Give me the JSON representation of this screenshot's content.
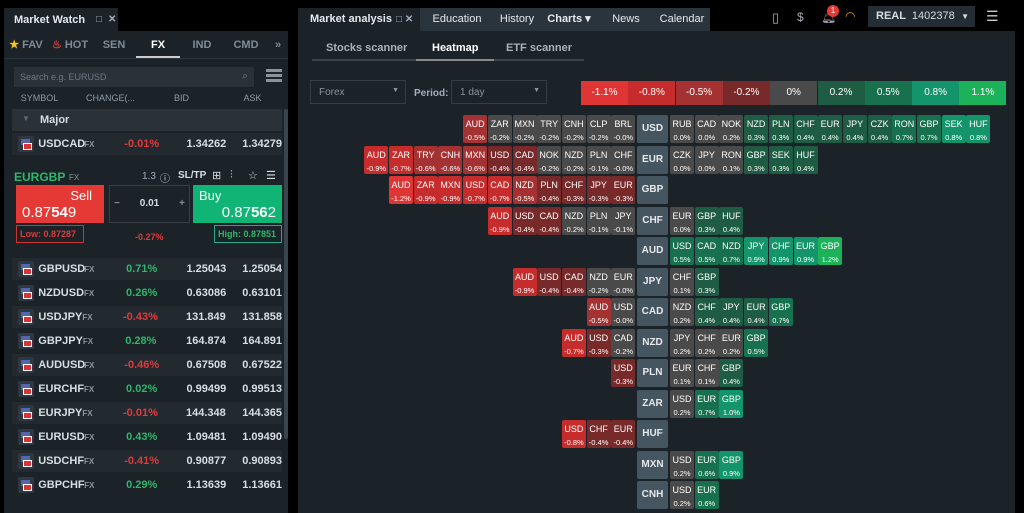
{
  "market_watch": {
    "title": "Market Watch",
    "tabs": [
      "FAV",
      "HOT",
      "SEN",
      "FX",
      "IND",
      "CMD"
    ],
    "active_tab": "FX",
    "search_placeholder": "Search e.g. EURUSD",
    "columns": [
      "SYMBOL",
      "CHANGE(...",
      "BID",
      "ASK"
    ],
    "group": "Major",
    "pinned": {
      "symbol": "USDCAD",
      "type": "FX",
      "change": "-0.01%",
      "bid": "1.34262",
      "ask": "1.34279"
    },
    "ticket": {
      "symbol": "EURGBP",
      "type": "FX",
      "spread": "1.3",
      "sltp": "SL/TP",
      "sell_label": "Sell",
      "sell_price_a": "0.87",
      "sell_price_b": "54",
      "sell_price_c": "9",
      "buy_label": "Buy",
      "buy_price_a": "0.87",
      "buy_price_b": "56",
      "buy_price_c": "2",
      "volume": "0.01",
      "low": "Low: 0.87287",
      "high": "High: 0.87851",
      "change": "-0.27%"
    },
    "rows": [
      {
        "symbol": "GBPUSD",
        "type": "FX",
        "change": "0.71%",
        "bid": "1.25043",
        "ask": "1.25054"
      },
      {
        "symbol": "NZDUSD",
        "type": "FX",
        "change": "0.26%",
        "bid": "0.63086",
        "ask": "0.63101"
      },
      {
        "symbol": "USDJPY",
        "type": "FX",
        "change": "-0.43%",
        "bid": "131.849",
        "ask": "131.858"
      },
      {
        "symbol": "GBPJPY",
        "type": "FX",
        "change": "0.28%",
        "bid": "164.874",
        "ask": "164.891"
      },
      {
        "symbol": "AUDUSD",
        "type": "FX",
        "change": "-0.46%",
        "bid": "0.67508",
        "ask": "0.67522"
      },
      {
        "symbol": "EURCHF",
        "type": "FX",
        "change": "0.02%",
        "bid": "0.99499",
        "ask": "0.99513"
      },
      {
        "symbol": "EURJPY",
        "type": "FX",
        "change": "-0.01%",
        "bid": "144.348",
        "ask": "144.365"
      },
      {
        "symbol": "EURUSD",
        "type": "FX",
        "change": "0.43%",
        "bid": "1.09481",
        "ask": "1.09490"
      },
      {
        "symbol": "USDCHF",
        "type": "FX",
        "change": "-0.41%",
        "bid": "0.90877",
        "ask": "0.90893"
      },
      {
        "symbol": "GBPCHF",
        "type": "FX",
        "change": "0.29%",
        "bid": "1.13639",
        "ask": "1.13661"
      }
    ]
  },
  "header": {
    "panel_title": "Market analysis",
    "tabs": [
      "Education",
      "History",
      "Charts ▾",
      "News",
      "Calendar"
    ],
    "notifications": "1",
    "account_type": "REAL",
    "account_number": "1402378"
  },
  "analysis": {
    "subtabs": [
      "Stocks scanner",
      "Heatmap",
      "ETF scanner"
    ],
    "active_subtab": "Heatmap",
    "market": "Forex",
    "period_label": "Period:",
    "period": "1 day",
    "legend": [
      {
        "label": "-1.1%",
        "color": "#e03535"
      },
      {
        "label": "-0.8%",
        "color": "#c62c2c"
      },
      {
        "label": "-0.5%",
        "color": "#a53232"
      },
      {
        "label": "-0.2%",
        "color": "#782a2a"
      },
      {
        "label": "0%",
        "color": "#4a4a4a"
      },
      {
        "label": "0.2%",
        "color": "#1e5c44"
      },
      {
        "label": "0.5%",
        "color": "#17704e"
      },
      {
        "label": "0.8%",
        "color": "#14946a"
      },
      {
        "label": "1.1%",
        "color": "#1bb25a"
      }
    ],
    "heatmap": [
      {
        "base": "USD",
        "left": [
          [
            "AUD",
            "-0.5%"
          ],
          [
            "ZAR",
            "-0.2%"
          ],
          [
            "MXN",
            "-0.2%"
          ],
          [
            "TRY",
            "-0.2%"
          ],
          [
            "CNH",
            "-0.2%"
          ],
          [
            "CLP",
            "-0.2%"
          ],
          [
            "BRL",
            "-0.0%"
          ]
        ],
        "right": [
          [
            "RUB",
            "0.0%"
          ],
          [
            "CAD",
            "0.0%"
          ],
          [
            "NOK",
            "0.2%"
          ],
          [
            "NZD",
            "0.3%"
          ],
          [
            "PLN",
            "0.3%"
          ],
          [
            "CHF",
            "0.4%"
          ],
          [
            "EUR",
            "0.4%"
          ],
          [
            "JPY",
            "0.4%"
          ],
          [
            "CZK",
            "0.4%"
          ],
          [
            "RON",
            "0.7%"
          ],
          [
            "GBP",
            "0.7%"
          ],
          [
            "SEK",
            "0.8%"
          ],
          [
            "HUF",
            "0.8%"
          ]
        ]
      },
      {
        "base": "EUR",
        "left": [
          [
            "AUD",
            "-0.9%"
          ],
          [
            "ZAR",
            "-0.7%"
          ],
          [
            "TRY",
            "-0.6%"
          ],
          [
            "CNH",
            "-0.6%"
          ],
          [
            "MXN",
            "-0.6%"
          ],
          [
            "USD",
            "-0.4%"
          ],
          [
            "CAD",
            "-0.4%"
          ],
          [
            "NOK",
            "-0.2%"
          ],
          [
            "NZD",
            "-0.2%"
          ],
          [
            "PLN",
            "-0.1%"
          ],
          [
            "CHF",
            "-0.0%"
          ]
        ],
        "right": [
          [
            "CZK",
            "0.0%"
          ],
          [
            "JPY",
            "0.0%"
          ],
          [
            "RON",
            "0.1%"
          ],
          [
            "GBP",
            "0.3%"
          ],
          [
            "SEK",
            "0.3%"
          ],
          [
            "HUF",
            "0.4%"
          ]
        ]
      },
      {
        "base": "GBP",
        "left": [
          [
            "AUD",
            "-1.2%"
          ],
          [
            "ZAR",
            "-0.9%"
          ],
          [
            "MXN",
            "-0.9%"
          ],
          [
            "USD",
            "-0.7%"
          ],
          [
            "CAD",
            "-0.7%"
          ],
          [
            "NZD",
            "-0.5%"
          ],
          [
            "PLN",
            "-0.4%"
          ],
          [
            "CHF",
            "-0.3%"
          ],
          [
            "JPY",
            "-0.3%"
          ],
          [
            "EUR",
            "-0.3%"
          ]
        ],
        "right": []
      },
      {
        "base": "CHF",
        "left": [
          [
            "AUD",
            "-0.9%"
          ],
          [
            "USD",
            "-0.4%"
          ],
          [
            "CAD",
            "-0.4%"
          ],
          [
            "NZD",
            "-0.2%"
          ],
          [
            "PLN",
            "-0.1%"
          ],
          [
            "JPY",
            "-0.1%"
          ]
        ],
        "right": [
          [
            "EUR",
            "0.0%"
          ],
          [
            "GBP",
            "0.3%"
          ],
          [
            "HUF",
            "0.4%"
          ]
        ]
      },
      {
        "base": "AUD",
        "left": [],
        "right": [
          [
            "USD",
            "0.5%"
          ],
          [
            "CAD",
            "0.5%"
          ],
          [
            "NZD",
            "0.7%"
          ],
          [
            "JPY",
            "0.9%"
          ],
          [
            "CHF",
            "0.9%"
          ],
          [
            "EUR",
            "0.9%"
          ],
          [
            "GBP",
            "1.2%"
          ]
        ]
      },
      {
        "base": "JPY",
        "left": [
          [
            "AUD",
            "-0.9%"
          ],
          [
            "USD",
            "-0.4%"
          ],
          [
            "CAD",
            "-0.4%"
          ],
          [
            "NZD",
            "-0.2%"
          ],
          [
            "EUR",
            "-0.0%"
          ]
        ],
        "right": [
          [
            "CHF",
            "0.1%"
          ],
          [
            "GBP",
            "0.3%"
          ]
        ]
      },
      {
        "base": "CAD",
        "left": [
          [
            "AUD",
            "-0.5%"
          ],
          [
            "USD",
            "-0.0%"
          ]
        ],
        "right": [
          [
            "NZD",
            "0.2%"
          ],
          [
            "CHF",
            "0.4%"
          ],
          [
            "JPY",
            "0.4%"
          ],
          [
            "EUR",
            "0.4%"
          ],
          [
            "GBP",
            "0.7%"
          ]
        ]
      },
      {
        "base": "NZD",
        "left": [
          [
            "AUD",
            "-0.7%"
          ],
          [
            "USD",
            "-0.3%"
          ],
          [
            "CAD",
            "-0.2%"
          ]
        ],
        "right": [
          [
            "JPY",
            "0.2%"
          ],
          [
            "CHF",
            "0.2%"
          ],
          [
            "EUR",
            "0.2%"
          ],
          [
            "GBP",
            "0.5%"
          ]
        ]
      },
      {
        "base": "PLN",
        "left": [
          [
            "USD",
            "-0.3%"
          ]
        ],
        "right": [
          [
            "EUR",
            "0.1%"
          ],
          [
            "CHF",
            "0.1%"
          ],
          [
            "GBP",
            "0.4%"
          ]
        ]
      },
      {
        "base": "ZAR",
        "left": [],
        "right": [
          [
            "USD",
            "0.2%"
          ],
          [
            "EUR",
            "0.7%"
          ],
          [
            "GBP",
            "1.0%"
          ]
        ]
      },
      {
        "base": "HUF",
        "left": [
          [
            "USD",
            "-0.8%"
          ],
          [
            "CHF",
            "-0.4%"
          ],
          [
            "EUR",
            "-0.4%"
          ]
        ],
        "right": []
      },
      {
        "base": "MXN",
        "left": [],
        "right": [
          [
            "USD",
            "0.2%"
          ],
          [
            "EUR",
            "0.6%"
          ],
          [
            "GBP",
            "0.9%"
          ]
        ]
      },
      {
        "base": "CNH",
        "left": [],
        "right": [
          [
            "USD",
            "0.2%"
          ],
          [
            "EUR",
            "0.6%"
          ]
        ]
      }
    ]
  }
}
